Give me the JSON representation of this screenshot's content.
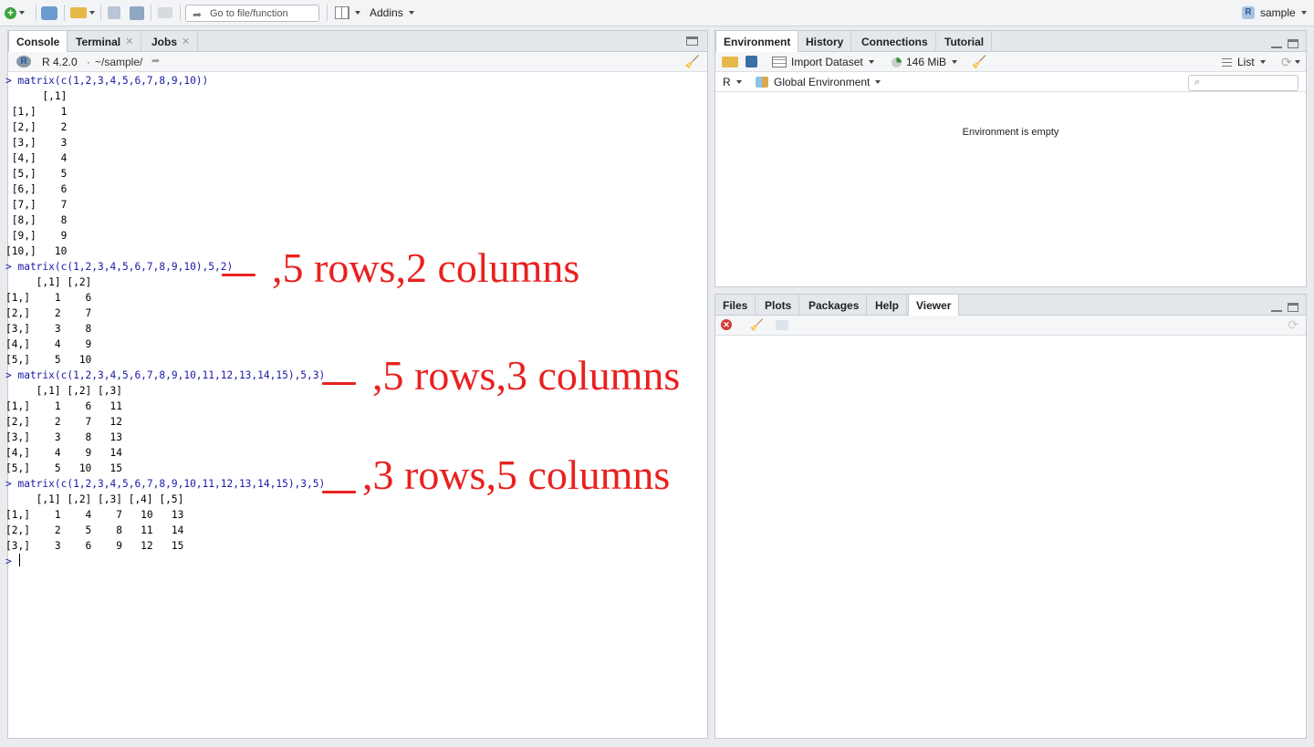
{
  "toolbar": {
    "goto_placeholder": "Go to file/function",
    "addins_label": "Addins",
    "project_label": "sample"
  },
  "console_pane": {
    "tabs": [
      "Console",
      "Terminal",
      "Jobs"
    ],
    "r_version": "R 4.2.0",
    "path": "~/sample/",
    "output": [
      {
        "type": "cmd",
        "text": "> matrix(c(1,2,3,4,5,6,7,8,9,10))"
      },
      {
        "type": "out",
        "text": "      [,1]"
      },
      {
        "type": "out",
        "text": " [1,]    1"
      },
      {
        "type": "out",
        "text": " [2,]    2"
      },
      {
        "type": "out",
        "text": " [3,]    3"
      },
      {
        "type": "out",
        "text": " [4,]    4"
      },
      {
        "type": "out",
        "text": " [5,]    5"
      },
      {
        "type": "out",
        "text": " [6,]    6"
      },
      {
        "type": "out",
        "text": " [7,]    7"
      },
      {
        "type": "out",
        "text": " [8,]    8"
      },
      {
        "type": "out",
        "text": " [9,]    9"
      },
      {
        "type": "out",
        "text": "[10,]   10"
      },
      {
        "type": "cmd",
        "text": "> matrix(c(1,2,3,4,5,6,7,8,9,10),5,2)"
      },
      {
        "type": "out",
        "text": "     [,1] [,2]"
      },
      {
        "type": "out",
        "text": "[1,]    1    6"
      },
      {
        "type": "out",
        "text": "[2,]    2    7"
      },
      {
        "type": "out",
        "text": "[3,]    3    8"
      },
      {
        "type": "out",
        "text": "[4,]    4    9"
      },
      {
        "type": "out",
        "text": "[5,]    5   10"
      },
      {
        "type": "cmd",
        "text": "> matrix(c(1,2,3,4,5,6,7,8,9,10,11,12,13,14,15),5,3)"
      },
      {
        "type": "out",
        "text": "     [,1] [,2] [,3]"
      },
      {
        "type": "out",
        "text": "[1,]    1    6   11"
      },
      {
        "type": "out",
        "text": "[2,]    2    7   12"
      },
      {
        "type": "out",
        "text": "[3,]    3    8   13"
      },
      {
        "type": "out",
        "text": "[4,]    4    9   14"
      },
      {
        "type": "out",
        "text": "[5,]    5   10   15"
      },
      {
        "type": "cmd",
        "text": "> matrix(c(1,2,3,4,5,6,7,8,9,10,11,12,13,14,15),3,5)"
      },
      {
        "type": "out",
        "text": "     [,1] [,2] [,3] [,4] [,5]"
      },
      {
        "type": "out",
        "text": "[1,]    1    4    7   10   13"
      },
      {
        "type": "out",
        "text": "[2,]    2    5    8   11   14"
      },
      {
        "type": "out",
        "text": "[3,]    3    6    9   12   15"
      },
      {
        "type": "prompt",
        "text": "> "
      }
    ],
    "annotations": [
      ",5 rows,2 columns",
      ",5 rows,3 columns",
      ",3 rows,5 columns"
    ]
  },
  "env_pane": {
    "tabs": [
      "Environment",
      "History",
      "Connections",
      "Tutorial"
    ],
    "import_label": "Import Dataset",
    "memory_label": "146 MiB",
    "list_label": "List",
    "lang_label": "R",
    "scope_label": "Global Environment",
    "empty_text": "Environment is empty"
  },
  "files_pane": {
    "tabs": [
      "Files",
      "Plots",
      "Packages",
      "Help",
      "Viewer"
    ]
  },
  "colors": {
    "annotation": "#e8211f",
    "command": "#1a1aa6"
  }
}
